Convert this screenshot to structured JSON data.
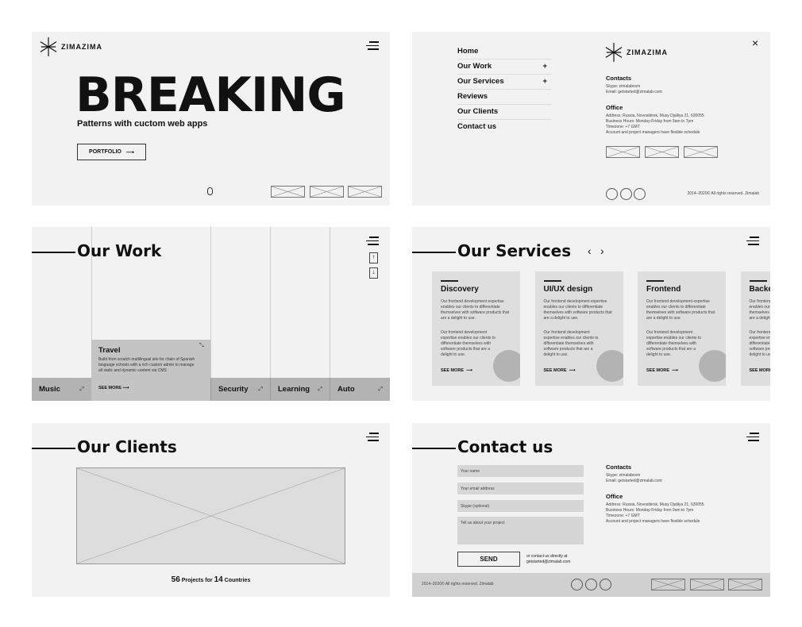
{
  "brand": "ZIMAZIMA",
  "hero": {
    "title": "BREAKING",
    "subtitle": "Patterns with cuctom web apps",
    "button": "PORTFOLIO"
  },
  "menu": {
    "items": [
      {
        "label": "Home",
        "plus": ""
      },
      {
        "label": "Our Work",
        "plus": "+"
      },
      {
        "label": "Our Services",
        "plus": "+"
      },
      {
        "label": "Reviews",
        "plus": ""
      },
      {
        "label": "Our Clients",
        "plus": ""
      },
      {
        "label": "Contact us",
        "plus": ""
      }
    ],
    "close": "×"
  },
  "contacts": {
    "title": "Contacts",
    "skype": "Skype: zimalabcom",
    "email": "Email: getstarted@zimalab.com"
  },
  "office": {
    "title": "Office",
    "address": "Address: Russia, Novosibirsk, Musy Djalilya 21, 630055",
    "hours": "Business Hours: Monday-Friday from 9am to 7pm",
    "timezone": "Timezone: +7 GMT",
    "note": "Account and project managers have flexible schedule"
  },
  "copyright": "2014–2020© All rights reserved. Zimalab",
  "work": {
    "title": "Our Work",
    "categories": [
      "Music",
      "Security",
      "Learning",
      "Auto"
    ],
    "featured": {
      "title": "Travel",
      "text": "Build from scratch multilingual site for chain of Spanish language schools with a rich custom admin to  manage all static and dynamic content via CMS",
      "more": "SEE MORE"
    },
    "up": "↑",
    "down": "↓"
  },
  "services": {
    "title": "Our Services",
    "prev": "‹",
    "next": "›",
    "paragraph1": "Our frontend development expertise enables our clients to differentiate themselves with software products that are a delight to use.",
    "paragraph2": "Our frontend development expertise enables our clients to differentiate themselves with software products that are a delight to use.",
    "more": "SEE MORE",
    "cards": [
      "Discovery",
      "UI/UX design",
      "Frontend",
      "Backend"
    ]
  },
  "clients": {
    "title": "Our Clients",
    "projects": "56",
    "projects_label": "Projects for",
    "countries": "14",
    "countries_label": "Countries"
  },
  "contact": {
    "title": "Contact us",
    "name_ph": "Your name",
    "email_ph": "Your email address",
    "skype_ph": "Skype (optional)",
    "project_ph": "Tell us about your project",
    "send": "SEND",
    "direct1": "or contact us directly at",
    "direct2": "getstarted@zimalab.com"
  }
}
